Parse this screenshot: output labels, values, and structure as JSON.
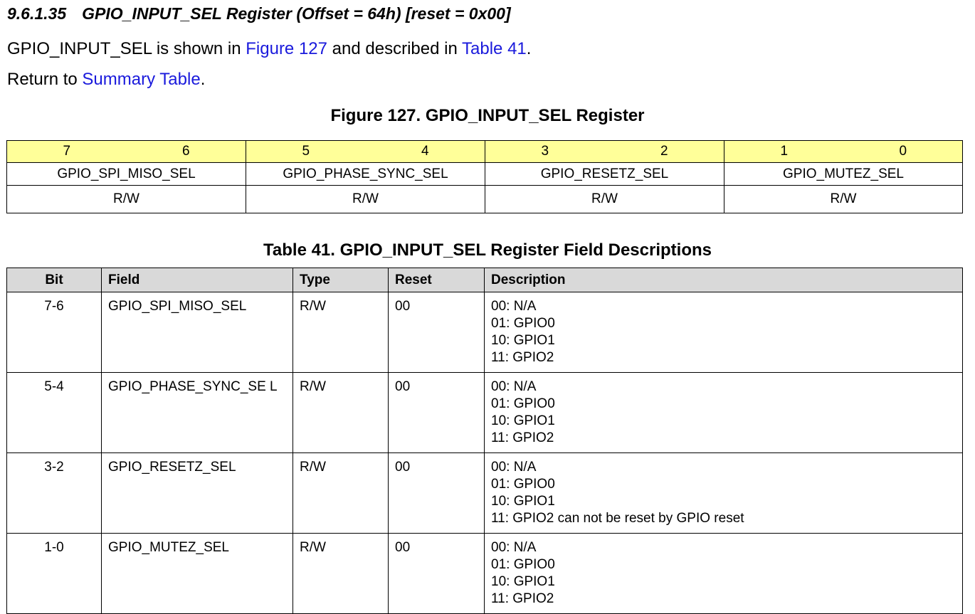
{
  "heading": {
    "number": "9.6.1.35",
    "title": "GPIO_INPUT_SEL Register (Offset = 64h) [reset = 0x00]"
  },
  "intro": {
    "prefix": "GPIO_INPUT_SEL is shown in ",
    "figure_link": "Figure 127",
    "middle": " and described in ",
    "table_link": "Table 41",
    "suffix": "."
  },
  "return_line": {
    "prefix": "Return to ",
    "link": "Summary Table",
    "suffix": "."
  },
  "figure": {
    "caption": "Figure 127.  GPIO_INPUT_SEL Register",
    "bits": [
      "7",
      "6",
      "5",
      "4",
      "3",
      "2",
      "1",
      "0"
    ],
    "fields": [
      "GPIO_SPI_MISO_SEL",
      "GPIO_PHASE_SYNC_SEL",
      "GPIO_RESETZ_SEL",
      "GPIO_MUTEZ_SEL"
    ],
    "access": [
      "R/W",
      "R/W",
      "R/W",
      "R/W"
    ]
  },
  "table": {
    "caption": "Table 41. GPIO_INPUT_SEL Register Field Descriptions",
    "headers": [
      "Bit",
      "Field",
      "Type",
      "Reset",
      "Description"
    ],
    "rows": [
      {
        "bit": "7-6",
        "field": "GPIO_SPI_MISO_SEL",
        "type": "R/W",
        "reset": "00",
        "description": [
          "00: N/A",
          "01: GPIO0",
          "10: GPIO1",
          "11: GPIO2"
        ]
      },
      {
        "bit": "5-4",
        "field": "GPIO_PHASE_SYNC_SE L",
        "type": "R/W",
        "reset": "00",
        "description": [
          "00: N/A",
          "01: GPIO0",
          "10: GPIO1",
          "11: GPIO2"
        ]
      },
      {
        "bit": "3-2",
        "field": "GPIO_RESETZ_SEL",
        "type": "R/W",
        "reset": "00",
        "description": [
          "00: N/A",
          "01: GPIO0",
          "10: GPIO1",
          "11: GPIO2 can not be reset by GPIO reset"
        ]
      },
      {
        "bit": "1-0",
        "field": "GPIO_MUTEZ_SEL",
        "type": "R/W",
        "reset": "00",
        "description": [
          "00: N/A",
          "01: GPIO0",
          "10: GPIO1",
          "11: GPIO2"
        ]
      }
    ]
  },
  "colors": {
    "link": "#1a1adc",
    "bit_row_bg": "#ffff99",
    "header_bg": "#d9d9d9"
  }
}
